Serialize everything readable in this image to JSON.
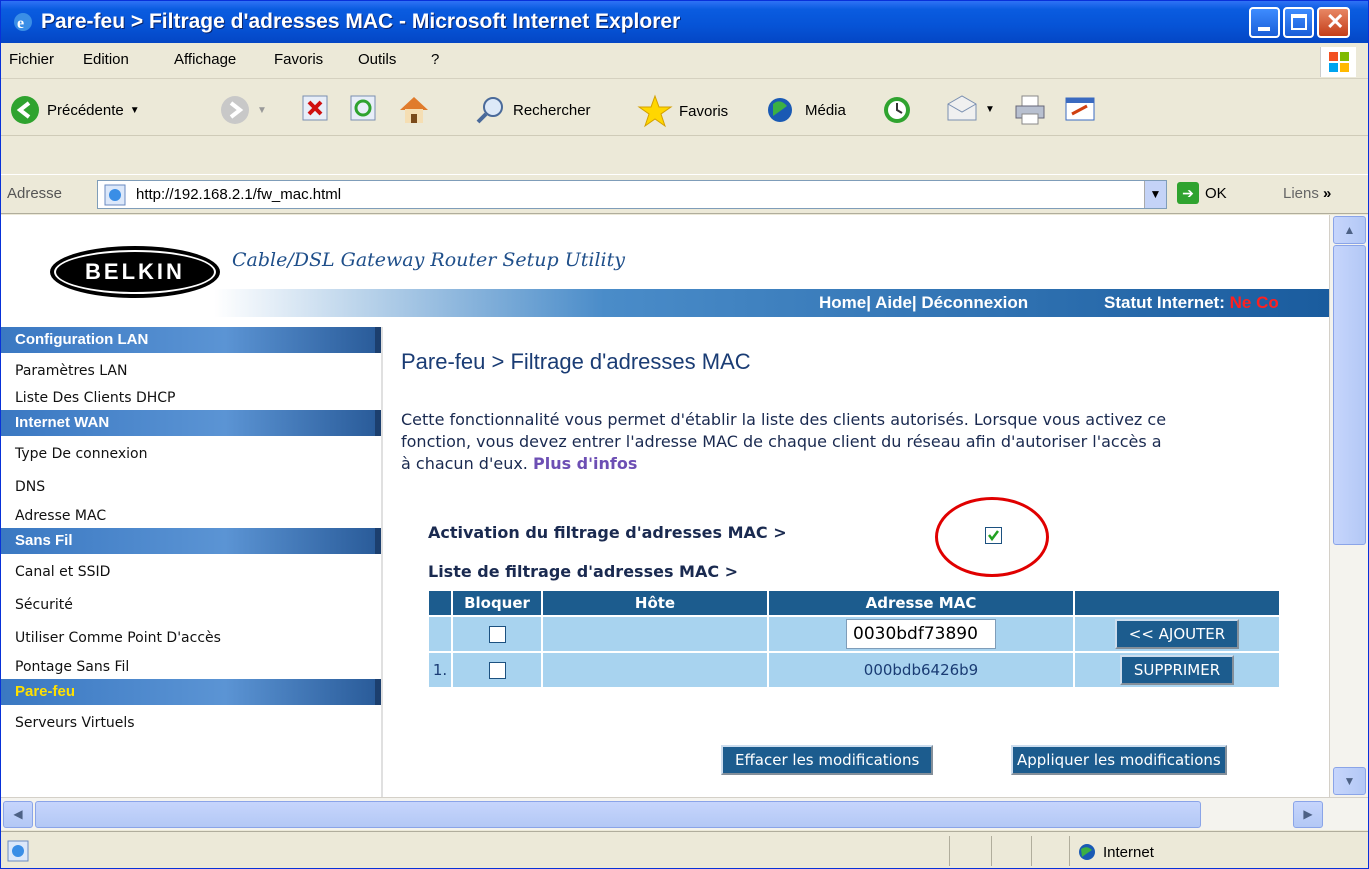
{
  "window": {
    "title": "Pare-feu > Filtrage d'adresses MAC - Microsoft Internet Explorer"
  },
  "menu": [
    "Fichier",
    "Edition",
    "Affichage",
    "Favoris",
    "Outils",
    "?"
  ],
  "toolbar": {
    "back": "Précédente",
    "search": "Rechercher",
    "favorites": "Favoris",
    "media": "Média"
  },
  "address": {
    "label": "Adresse",
    "url": "http://192.168.2.1/fw_mac.html",
    "go": "OK",
    "links": "Liens"
  },
  "header": {
    "brand": "BELKIN",
    "subtitle": "Cable/DSL Gateway Router Setup Utility",
    "links": "Home| Aide| Déconnexion",
    "status_label": "Statut Internet:",
    "status_value": "Ne Co"
  },
  "sidebar": {
    "sections": [
      {
        "title": "Configuration LAN",
        "items": [
          "Paramètres LAN",
          "Liste Des Clients DHCP"
        ]
      },
      {
        "title": "Internet WAN",
        "items": [
          "Type De connexion",
          "DNS",
          "Adresse MAC"
        ]
      },
      {
        "title": "Sans Fil",
        "items": [
          "Canal et SSID",
          "Sécurité",
          "Utiliser Comme Point D'accès",
          "Pontage Sans Fil"
        ]
      },
      {
        "title": "Pare-feu",
        "items": [
          "Serveurs Virtuels"
        ]
      }
    ]
  },
  "main": {
    "title": "Pare-feu > Filtrage d'adresses MAC",
    "desc_line1": "Cette fonctionnalité vous permet d'établir la liste des clients autorisés. Lorsque vous activez ce",
    "desc_line2": "fonction, vous devez entrer l'adresse MAC de chaque client du réseau afin d'autoriser l'accès a",
    "desc_line3": "à chacun d'eux.",
    "more_info": "Plus d'infos",
    "enable_label": "Activation du filtrage d'adresses MAC >",
    "enable_checked": true,
    "list_label": "Liste de filtrage d'adresses MAC >",
    "table_headers": [
      "",
      "Bloquer",
      "Hôte",
      "Adresse MAC",
      ""
    ],
    "new_mac": "0030bdf73890",
    "add_button": "<< AJOUTER",
    "rows": [
      {
        "num": "1.",
        "mac": "000bdb6426b9",
        "button": "SUPPRIMER"
      }
    ],
    "clear_button": "Effacer les modifications",
    "apply_button": "Appliquer les modifications"
  },
  "statusbar": {
    "zone": "Internet"
  }
}
